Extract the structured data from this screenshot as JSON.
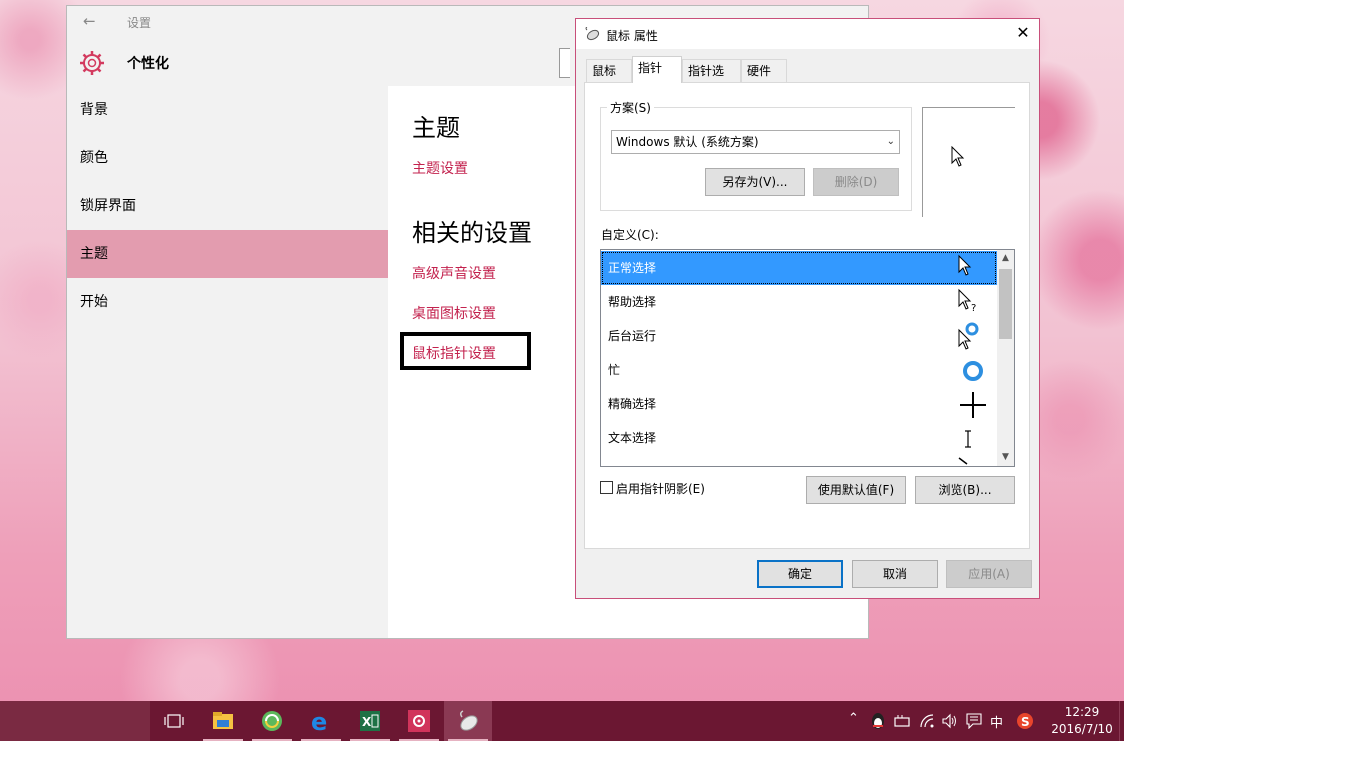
{
  "settings_window": {
    "title": "设置",
    "back_glyph": "←",
    "header": "个性化",
    "nav_items": [
      {
        "label": "背景"
      },
      {
        "label": "颜色"
      },
      {
        "label": "锁屏界面"
      },
      {
        "label": "主题",
        "selected": true
      },
      {
        "label": "开始"
      }
    ],
    "section_theme": "主题",
    "link_theme_settings": "主题设置",
    "section_related": "相关的设置",
    "link_sound": "高级声音设置",
    "link_desktop_icons": "桌面图标设置",
    "link_mouse_pointer": "鼠标指针设置"
  },
  "mouse_dialog": {
    "title": "鼠标 属性",
    "close_glyph": "✕",
    "tabs": [
      "鼠标键",
      "指针",
      "指针选项",
      "硬件"
    ],
    "selected_tab": "指针",
    "scheme_label": "方案(S)",
    "scheme_value": "Windows 默认 (系统方案)",
    "save_as_label": "另存为(V)...",
    "delete_label": "删除(D)",
    "customize_label": "自定义(C):",
    "cursor_rows": [
      {
        "label": "正常选择",
        "icon": "arrow-cursor-icon",
        "selected": true
      },
      {
        "label": "帮助选择",
        "icon": "help-cursor-icon"
      },
      {
        "label": "后台运行",
        "icon": "working-in-background-cursor-icon"
      },
      {
        "label": "忙",
        "icon": "busy-cursor-icon"
      },
      {
        "label": "精确选择",
        "icon": "crosshair-cursor-icon"
      },
      {
        "label": "文本选择",
        "icon": "text-beam-cursor-icon"
      }
    ],
    "shadow_label": "启用指针阴影(E)",
    "shadow_checked": false,
    "use_default_label": "使用默认值(F)",
    "browse_label": "浏览(B)...",
    "ok_label": "确定",
    "cancel_label": "取消",
    "apply_label": "应用(A)"
  },
  "taskbar": {
    "tray_ime": "中",
    "clock_time": "12:29",
    "clock_date": "2016/7/10"
  },
  "colors": {
    "accent_link": "#c3224e",
    "nav_selected": "#e39caf",
    "taskbar": "#6b1732",
    "list_selection": "#3399ff"
  }
}
